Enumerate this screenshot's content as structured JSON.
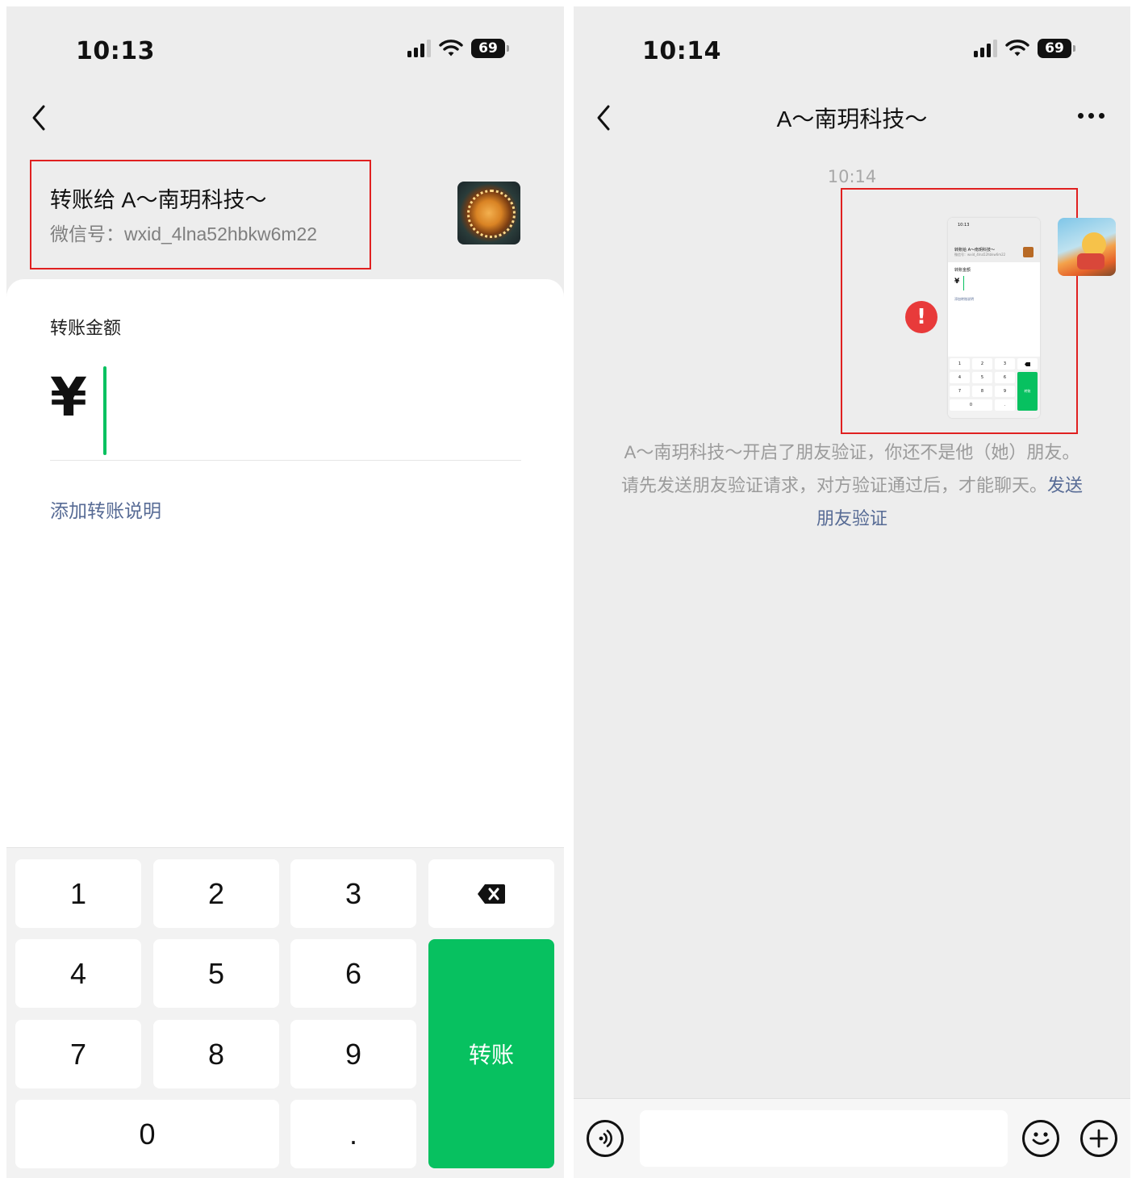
{
  "left": {
    "status": {
      "time": "10:13",
      "battery": "69"
    },
    "payee": {
      "title": "转账给 A～南玥科技～",
      "wechat_id": "微信号：wxid_4lna52hbkw6m22"
    },
    "amount_label": "转账金额",
    "currency": "¥",
    "add_note": "添加转账说明",
    "keypad": {
      "k1": "1",
      "k2": "2",
      "k3": "3",
      "k4": "4",
      "k5": "5",
      "k6": "6",
      "k7": "7",
      "k8": "8",
      "k9": "9",
      "k0": "0",
      "dot": ".",
      "transfer": "转账"
    }
  },
  "right": {
    "status": {
      "time": "10:14",
      "battery": "69"
    },
    "chat_title": "A～南玥科技～",
    "message_time": "10:14",
    "system_note": {
      "text": "A～南玥科技～开启了朋友验证，你还不是他（她）朋友。请先发送朋友验证请求，对方验证通过后，才能聊天。",
      "link": "发送朋友验证"
    },
    "thumbnail": {
      "time": "10:13",
      "name": "转账给 A～南玥科技～",
      "wechat_id": "微信号：wxid_4lna52hbkw6m22",
      "amount_label": "转账金额",
      "currency": "¥",
      "add_note": "添加转账说明",
      "keys": [
        "1",
        "2",
        "3",
        "4",
        "5",
        "6",
        "7",
        "8",
        "9",
        "0",
        "."
      ],
      "transfer": "转账"
    },
    "error_mark": "!"
  },
  "colors": {
    "accent_green": "#07c160",
    "link_blue": "#576b95",
    "error_red": "#e83a3a",
    "highlight_red": "#e02020",
    "background_gray": "#ededed"
  },
  "icons": [
    "back-icon",
    "signal-icon",
    "wifi-icon",
    "battery-icon",
    "backspace-icon",
    "more-icon",
    "voice-icon",
    "emoji-icon",
    "plus-icon",
    "error-icon"
  ]
}
